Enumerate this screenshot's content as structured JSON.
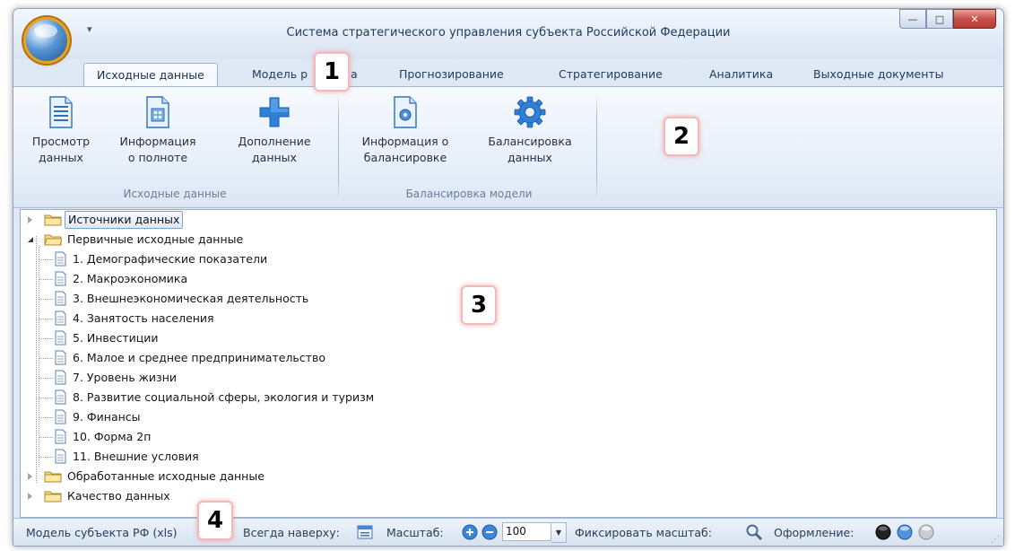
{
  "window": {
    "title": "Система стратегического управления субъекта Российской Федерации",
    "qat_glyph": "▾",
    "minimize_glyph": "—",
    "maximize_glyph": "□",
    "close_glyph": "✕"
  },
  "tabs": [
    {
      "label": "Исходные данные"
    },
    {
      "label": "Модель р"
    },
    {
      "label": "а"
    },
    {
      "label": "Прогнозирование"
    },
    {
      "label": "Стратегирование"
    },
    {
      "label": "Аналитика"
    },
    {
      "label": "Выходные документы"
    }
  ],
  "ribbon": {
    "group1": {
      "label": "Исходные данные",
      "buttons": [
        {
          "line1": "Просмотр",
          "line2": "данных"
        },
        {
          "line1": "Информация",
          "line2": "о полноте"
        },
        {
          "line1": "Дополнение",
          "line2": "данных"
        }
      ]
    },
    "group2": {
      "label": "Балансировка модели",
      "buttons": [
        {
          "line1": "Информация о",
          "line2": "балансировке"
        },
        {
          "line1": "Балансировка",
          "line2": "данных"
        }
      ]
    }
  },
  "tree": {
    "nodes": [
      {
        "label": "Источники данных"
      },
      {
        "label": "Первичные исходные данные"
      },
      {
        "label": "Обработанные исходные данные"
      },
      {
        "label": "Качество данных"
      }
    ],
    "children": [
      {
        "label": "1. Демографические показатели"
      },
      {
        "label": "2. Макроэкономика"
      },
      {
        "label": "3. Внешнеэкономическая деятельность"
      },
      {
        "label": "4. Занятость населения"
      },
      {
        "label": "5. Инвестиции"
      },
      {
        "label": "6. Малое и среднее предпринимательство"
      },
      {
        "label": "7. Уровень жизни"
      },
      {
        "label": "8. Развитие социальной сферы, экология и туризм"
      },
      {
        "label": "9. Финансы"
      },
      {
        "label": "10. Форма 2п"
      },
      {
        "label": "11. Внешние условия"
      }
    ]
  },
  "statusbar": {
    "model": "Модель субъекта РФ (xls)",
    "always_on_top": "Всегда наверху:",
    "scale": "Масштаб:",
    "zoom_value": "100",
    "fix_scale": "Фиксировать масштаб:",
    "theme": "Оформление:"
  },
  "callouts": [
    "1",
    "2",
    "3",
    "4"
  ],
  "colors": {
    "accent": "#2e80d8",
    "ribbon_bg": "#e6eef8",
    "callout_border": "#f4b8b8"
  }
}
